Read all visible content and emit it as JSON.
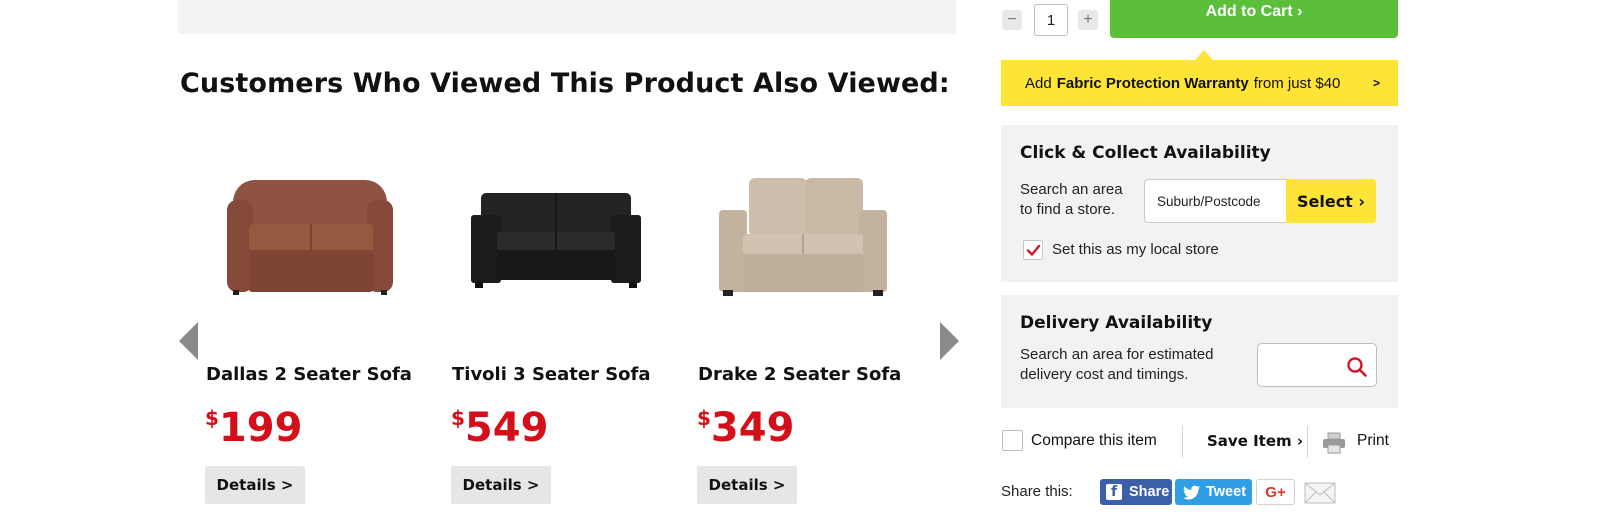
{
  "section_title": "Customers Who Viewed This Product Also Viewed:",
  "products": [
    {
      "name": "Dallas 2 Seater Sofa",
      "currency": "$",
      "price": "199",
      "details_label": "Details >",
      "color": "#8a4f3b"
    },
    {
      "name": "Tivoli 3 Seater Sofa",
      "currency": "$",
      "price": "549",
      "details_label": "Details >",
      "color": "#1f1f1f"
    },
    {
      "name": "Drake 2 Seater Sofa",
      "currency": "$",
      "price": "349",
      "details_label": "Details >",
      "color": "#c9b9a6"
    }
  ],
  "cart": {
    "quantity": "1",
    "minus_icon": "minus-icon",
    "plus_icon": "plus-icon",
    "add_to_cart_label": "Add to Cart ›"
  },
  "warranty": {
    "prefix": "Add",
    "bold": "Fabric Protection Warranty",
    "suffix": "from just $40",
    "chevron": ">"
  },
  "click_collect": {
    "title": "Click & Collect Availability",
    "text_line1": "Search an area",
    "text_line2": "to find a store.",
    "input_placeholder": "Suburb/Postcode",
    "select_label": "Select ›",
    "local_store_label": "Set this as my local store",
    "local_store_checked": true
  },
  "delivery": {
    "title": "Delivery Availability",
    "text_line1": "Search an area for estimated",
    "text_line2": "delivery cost and timings."
  },
  "actions": {
    "compare_label": "Compare this item",
    "save_label": "Save Item ›",
    "print_label": "Print"
  },
  "share": {
    "label": "Share this:",
    "facebook_label": "Share",
    "twitter_label": "Tweet",
    "gplus_label": "G+"
  },
  "colors": {
    "accent_green": "#5bbf3a",
    "accent_yellow": "#ffe438",
    "price_red": "#d50f1a",
    "facebook_blue": "#3b5fa8",
    "twitter_blue": "#2f9ee4"
  }
}
